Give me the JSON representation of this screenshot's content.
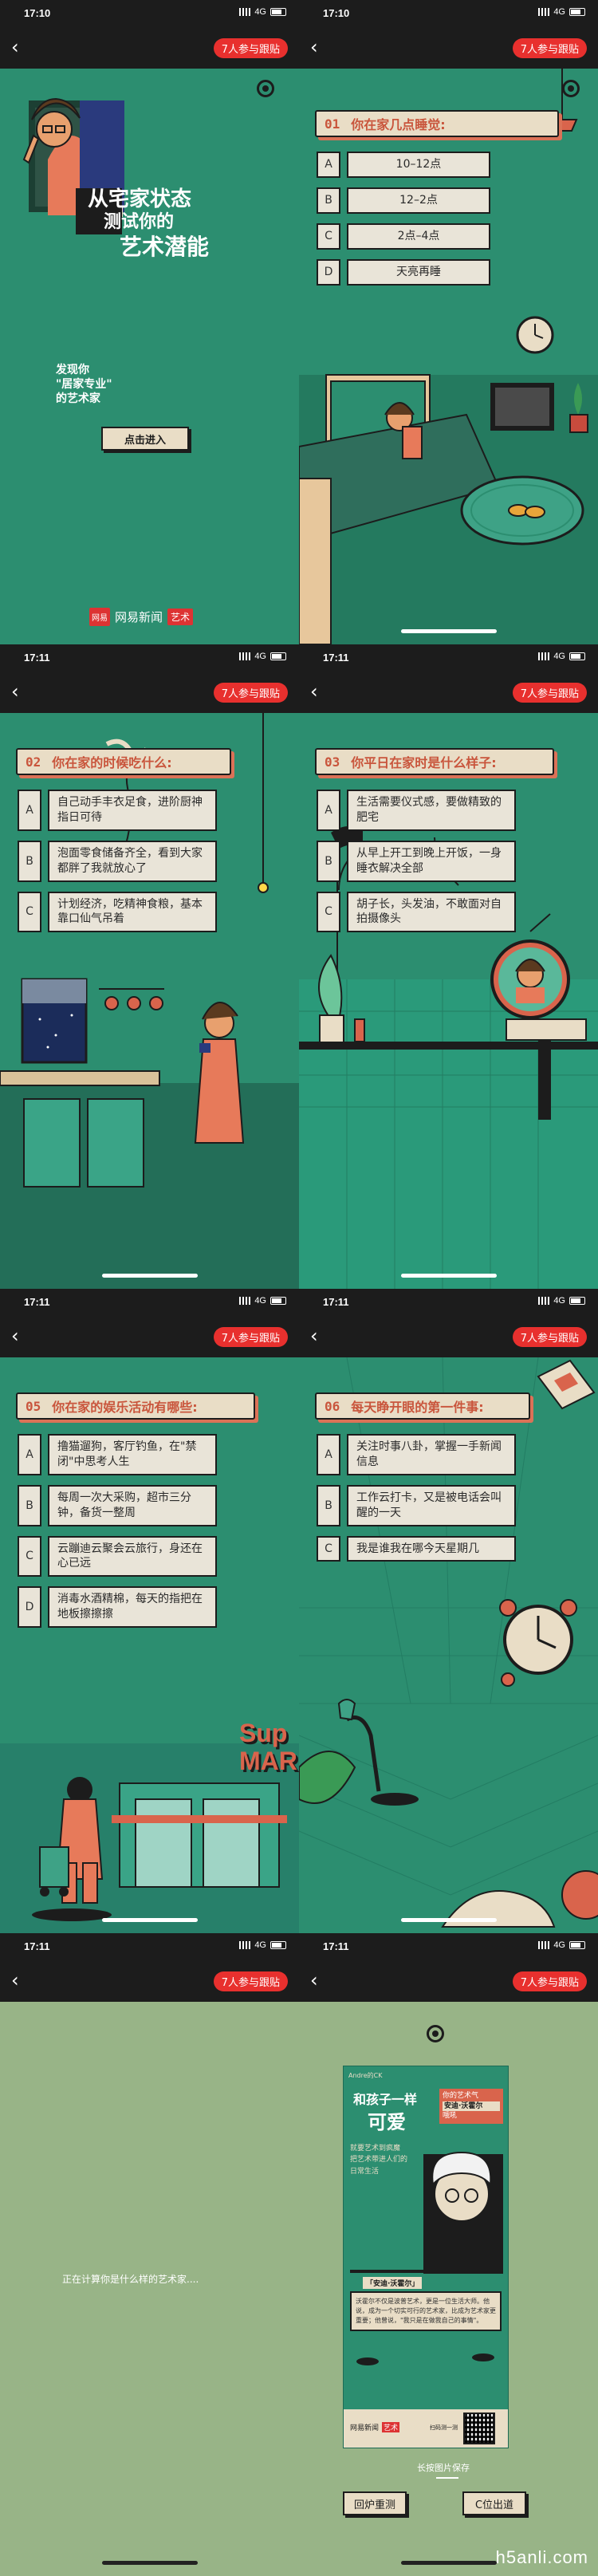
{
  "status": [
    {
      "time": "17:10",
      "net": "4G"
    },
    {
      "time": "17:10",
      "net": "4G"
    },
    {
      "time": "17:11",
      "net": "4G"
    },
    {
      "time": "17:11",
      "net": "4G"
    },
    {
      "time": "17:11",
      "net": "4G"
    },
    {
      "time": "17:11",
      "net": "4G"
    },
    {
      "time": "17:11",
      "net": "4G"
    },
    {
      "time": "17:11",
      "net": "4G"
    }
  ],
  "join_label": "7人参与跟贴",
  "cover": {
    "title_l1": "从宅家状态",
    "title_l2": "测试你的",
    "title_l3": "艺术潜能",
    "subtitle_l1": "发现你",
    "subtitle_l2": "\"居家专业\"",
    "subtitle_l3": "的艺术家",
    "enter": "点击进入",
    "logo_text": "网易新闻",
    "logo_art": "艺术",
    "logo_badge": "网易"
  },
  "q1": {
    "num": "01",
    "title": "你在家几点睡觉:",
    "options": [
      {
        "l": "A",
        "t": "10–12点"
      },
      {
        "l": "B",
        "t": "12–2点"
      },
      {
        "l": "C",
        "t": "2点–4点"
      },
      {
        "l": "D",
        "t": "天亮再睡"
      }
    ]
  },
  "q2": {
    "num": "02",
    "title": "你在家的时候吃什么:",
    "options": [
      {
        "l": "A",
        "t": "自己动手丰衣足食，进阶厨神指日可待"
      },
      {
        "l": "B",
        "t": "泡面零食储备齐全，看到大家都胖了我就放心了"
      },
      {
        "l": "C",
        "t": "计划经济，吃精神食粮，基本靠口仙气吊着"
      }
    ]
  },
  "q3": {
    "num": "03",
    "title": "你平日在家时是什么样子:",
    "options": [
      {
        "l": "A",
        "t": "生活需要仪式感，要做精致的肥宅"
      },
      {
        "l": "B",
        "t": "从早上开工到晚上开饭，一身睡衣解决全部"
      },
      {
        "l": "C",
        "t": "胡子长，头发油，不敢面对自拍摄像头"
      }
    ]
  },
  "q4": {
    "num": "05",
    "title": "你在家的娱乐活动有哪些:",
    "options": [
      {
        "l": "A",
        "t": "撸猫遛狗，客厅钓鱼，在\"禁闭\"中思考人生"
      },
      {
        "l": "B",
        "t": "每周一次大采购，超市三分钟，备货一整周"
      },
      {
        "l": "C",
        "t": "云蹦迪云聚会云旅行，身还在心已远"
      },
      {
        "l": "D",
        "t": "消毒水酒精棉，每天的指把在地板擦擦擦"
      }
    ],
    "wall": "Sup MAR"
  },
  "q5": {
    "num": "06",
    "title": "每天睁开眼的第一件事:",
    "options": [
      {
        "l": "A",
        "t": "关注时事八卦，掌握一手新闻信息"
      },
      {
        "l": "B",
        "t": "工作云打卡，又是被电话会叫醒的一天"
      },
      {
        "l": "C",
        "t": "我是谁我在哪今天星期几"
      }
    ]
  },
  "result": {
    "loading": "正在计算你是什么样的艺术家....",
    "card_user": "Andre的CK",
    "card_title_l1": "和孩子一样",
    "card_title_l2": "可爱",
    "card_side_l1": "你的艺术气",
    "card_side_l2": "安迪·沃霍尔",
    "card_side_l3": "哦吼",
    "card_quote_l1": "就要艺术到疯魔",
    "card_quote_l2": "把艺术带进人们的",
    "card_quote_l3": "日常生活",
    "card_tag": "「安迪·沃霍尔」",
    "card_desc": "沃霍尔不仅是波普艺术，更是一位生活大师。他说，成为一个切实可行的艺术家，比成为艺术家更重要；他曾说，\"我只是在做我自己的事情\"。",
    "card_footer": "网易新闻",
    "card_footer_art": "艺术",
    "card_scan": "扫码测一测",
    "save_hint": "长按图片保存",
    "btn_retry": "回炉重测",
    "btn_out": "C位出道"
  },
  "watermark": "h5anli.com"
}
